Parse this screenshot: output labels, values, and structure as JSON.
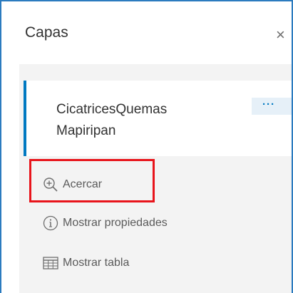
{
  "panel": {
    "title": "Capas",
    "close_glyph": "×"
  },
  "layer": {
    "name_line1": "CicatricesQuemas",
    "name_line2": "Mapiripan",
    "options_glyph": "···"
  },
  "actions": [
    {
      "label": "Acercar",
      "icon": "zoom-in-icon"
    },
    {
      "label": "Mostrar propiedades",
      "icon": "info-icon"
    },
    {
      "label": "Mostrar tabla",
      "icon": "table-icon"
    }
  ],
  "colors": {
    "frame_blue": "#2b7bbf",
    "accent_blue": "#0079c1",
    "highlight_red": "#e8141b",
    "content_gray": "#f3f3f3"
  }
}
